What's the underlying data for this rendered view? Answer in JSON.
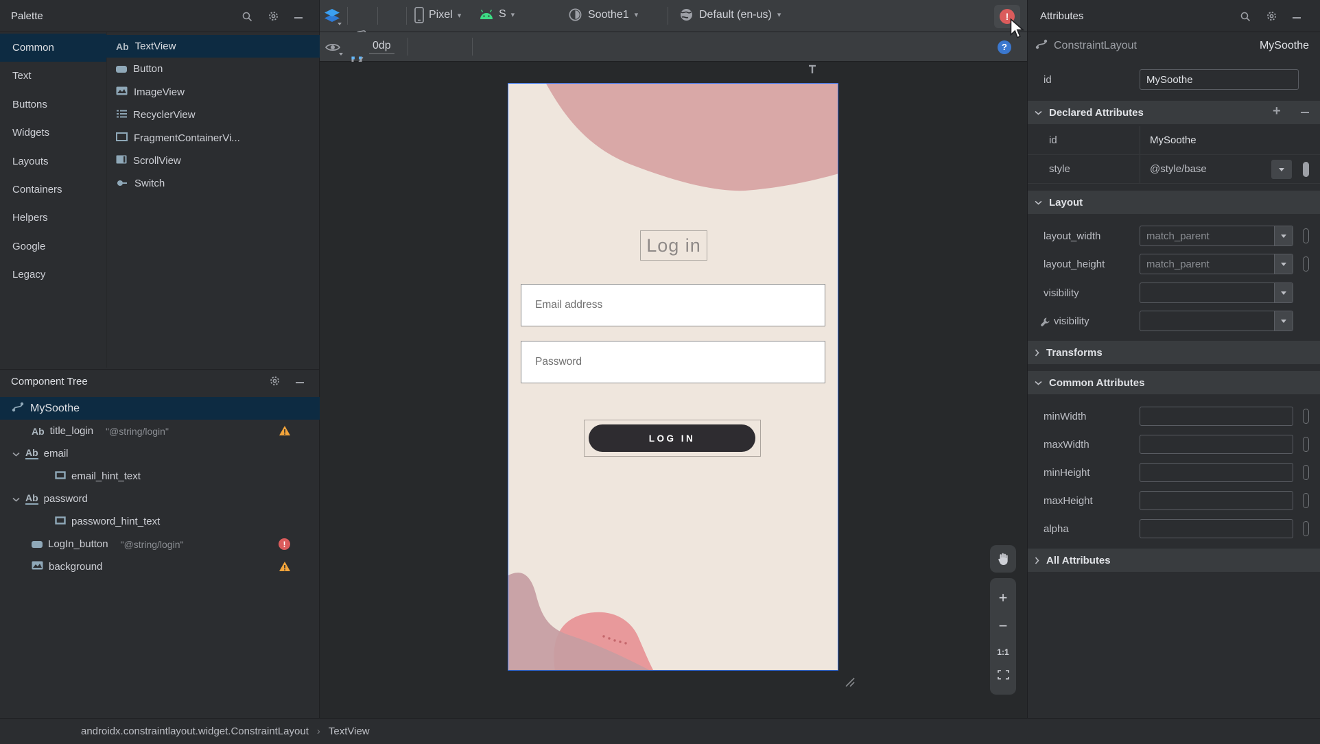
{
  "colors": {
    "accent": "#3574F0",
    "selection": "#0D2B42",
    "error": "#DB5C5C",
    "warning": "#F2A43B",
    "phone-bg": "#EFE6DD",
    "blob-top": "#D9A8A7",
    "blob-mauve": "#C69DA2",
    "blob-pink": "#E8999B",
    "btn-dark": "#2E2C30"
  },
  "palette": {
    "title": "Palette",
    "categories": [
      {
        "label": "Common",
        "selected": true
      },
      {
        "label": "Text"
      },
      {
        "label": "Buttons"
      },
      {
        "label": "Widgets"
      },
      {
        "label": "Layouts"
      },
      {
        "label": "Containers"
      },
      {
        "label": "Helpers"
      },
      {
        "label": "Google"
      },
      {
        "label": "Legacy"
      }
    ],
    "items": [
      {
        "label": "TextView",
        "icon": "textview-ab-icon",
        "selected": true
      },
      {
        "label": "Button",
        "icon": "button-icon"
      },
      {
        "label": "ImageView",
        "icon": "imageview-icon"
      },
      {
        "label": "RecyclerView",
        "icon": "recyclerview-icon"
      },
      {
        "label": "FragmentContainerVi...",
        "icon": "fragment-container-icon"
      },
      {
        "label": "ScrollView",
        "icon": "scrollview-icon"
      },
      {
        "label": "Switch",
        "icon": "switch-icon"
      }
    ]
  },
  "component_tree": {
    "title": "Component Tree",
    "rows": [
      {
        "label": "MySoothe",
        "icon": "constraint-layout-icon",
        "selected": true
      },
      {
        "label": "title_login",
        "value": "\"@string/login\"",
        "icon": "textview-ab-icon",
        "badge": "warning"
      },
      {
        "label": "email",
        "icon": "edittext-icon",
        "expanded": true
      },
      {
        "label": "email_hint_text",
        "icon": "view-rect-icon"
      },
      {
        "label": "password",
        "icon": "edittext-icon",
        "expanded": true
      },
      {
        "label": "password_hint_text",
        "icon": "view-rect-icon"
      },
      {
        "label": "LogIn_button",
        "value": "\"@string/login\"",
        "icon": "button-icon",
        "badge": "error"
      },
      {
        "label": "background",
        "icon": "imageview-icon",
        "badge": "warning"
      }
    ]
  },
  "toolbar": {
    "device": "Pixel",
    "api": "S",
    "theme": "Soothe1",
    "locale": "Default (en-us)",
    "default_margin": "0dp"
  },
  "canvas": {
    "screen": {
      "title": "Log in",
      "email_hint": "Email address",
      "password_hint": "Password",
      "login_button": "LOG IN"
    },
    "zoom_100": "1:1"
  },
  "attributes": {
    "title": "Attributes",
    "component_type": "ConstraintLayout",
    "component_id": "MySoothe",
    "id_label": "id",
    "id_value": "MySoothe",
    "sections": {
      "declared": {
        "title": "Declared Attributes",
        "rows": [
          {
            "name": "id",
            "value": "MySoothe"
          },
          {
            "name": "style",
            "value": "@style/base"
          }
        ]
      },
      "layout": {
        "title": "Layout",
        "rows": [
          {
            "name": "layout_width",
            "value": "match_parent"
          },
          {
            "name": "layout_height",
            "value": "match_parent"
          },
          {
            "name": "visibility",
            "value": ""
          },
          {
            "name": "visibility",
            "value": "",
            "wrench": true
          }
        ]
      },
      "transforms": {
        "title": "Transforms"
      },
      "common": {
        "title": "Common Attributes",
        "rows": [
          {
            "name": "minWidth",
            "value": ""
          },
          {
            "name": "maxWidth",
            "value": ""
          },
          {
            "name": "minHeight",
            "value": ""
          },
          {
            "name": "maxHeight",
            "value": ""
          },
          {
            "name": "alpha",
            "value": ""
          }
        ]
      },
      "all": {
        "title": "All Attributes"
      }
    }
  },
  "statusbar": {
    "breadcrumb": [
      "androidx.constraintlayout.widget.ConstraintLayout",
      "TextView"
    ]
  }
}
